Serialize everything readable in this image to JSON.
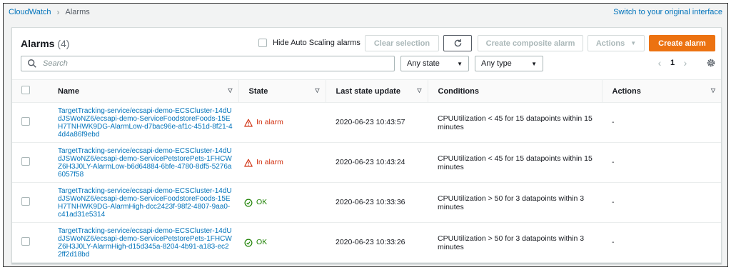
{
  "breadcrumb": {
    "root": "CloudWatch",
    "current": "Alarms"
  },
  "switch_link": "Switch to your original interface",
  "panel": {
    "title": "Alarms",
    "count": "(4)",
    "hide_autoscaling_label": "Hide Auto Scaling alarms",
    "clear_selection": "Clear selection",
    "create_composite": "Create composite alarm",
    "actions": "Actions",
    "create_alarm": "Create alarm"
  },
  "search": {
    "placeholder": "Search"
  },
  "filters": {
    "state": "Any state",
    "type": "Any type"
  },
  "pagination": {
    "page": "1"
  },
  "columns": [
    "Name",
    "State",
    "Last state update",
    "Conditions",
    "Actions"
  ],
  "rows": [
    {
      "name": "TargetTracking-service/ecsapi-demo-ECSCluster-14dUdJSWoNZ6/ecsapi-demo-ServiceFoodstoreFoods-15EH7TNHWK9DG-AlarmLow-d7bac96e-af1c-451d-8f21-44d4a86f9ebd",
      "state": "In alarm",
      "state_kind": "alarm",
      "updated": "2020-06-23 10:43:57",
      "condition": "CPUUtilization < 45 for 15 datapoints within 15 minutes",
      "actions": "-"
    },
    {
      "name": "TargetTracking-service/ecsapi-demo-ECSCluster-14dUdJSWoNZ6/ecsapi-demo-ServicePetstorePets-1FHCWZ6H3J0LY-AlarmLow-b6d64884-6bfe-4780-8df5-5276a6057f58",
      "state": "In alarm",
      "state_kind": "alarm",
      "updated": "2020-06-23 10:43:24",
      "condition": "CPUUtilization < 45 for 15 datapoints within 15 minutes",
      "actions": "-"
    },
    {
      "name": "TargetTracking-service/ecsapi-demo-ECSCluster-14dUdJSWoNZ6/ecsapi-demo-ServiceFoodstoreFoods-15EH7TNHWK9DG-AlarmHigh-dcc2423f-98f2-4807-9aa0-c41ad31e5314",
      "state": "OK",
      "state_kind": "ok",
      "updated": "2020-06-23 10:33:36",
      "condition": "CPUUtilization > 50 for 3 datapoints within 3 minutes",
      "actions": "-"
    },
    {
      "name": "TargetTracking-service/ecsapi-demo-ECSCluster-14dUdJSWoNZ6/ecsapi-demo-ServicePetstorePets-1FHCWZ6H3J0LY-AlarmHigh-d15d345a-8204-4b91-a183-ec22ff2d18bd",
      "state": "OK",
      "state_kind": "ok",
      "updated": "2020-06-23 10:33:26",
      "condition": "CPUUtilization > 50 for 3 datapoints within 3 minutes",
      "actions": "-"
    }
  ],
  "colors": {
    "link": "#0073bb",
    "alarm": "#d13212",
    "ok": "#1d8102",
    "primary": "#ec7211"
  }
}
